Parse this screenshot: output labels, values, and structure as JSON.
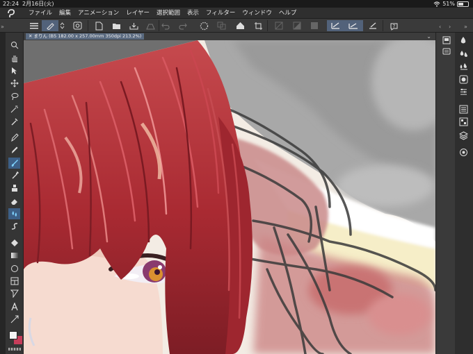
{
  "status": {
    "time": "22:24",
    "date": "2月16日(火)",
    "battery": "51%",
    "battery_level": 0.51
  },
  "menu": [
    "ファイル",
    "編集",
    "アニメーション",
    "レイヤー",
    "選択範囲",
    "表示",
    "フィルター",
    "ウィンドウ",
    "ヘルプ"
  ],
  "document": {
    "tab_label": "まりん (B5 182.00 x 257.00mm 350dpi 213.2%)"
  },
  "icons": {
    "menu": "hamburger-icon",
    "new": "new-file-icon",
    "open": "open-folder-icon",
    "save": "save-icon",
    "undo": "undo-icon",
    "redo": "redo-icon",
    "settings": "gear-icon",
    "help": "help-icon"
  },
  "colors": {
    "accent": "#3d5f86",
    "main_color": "#f4f4f4",
    "sub_color": "#c63d5a",
    "hair": "#b4303a"
  }
}
